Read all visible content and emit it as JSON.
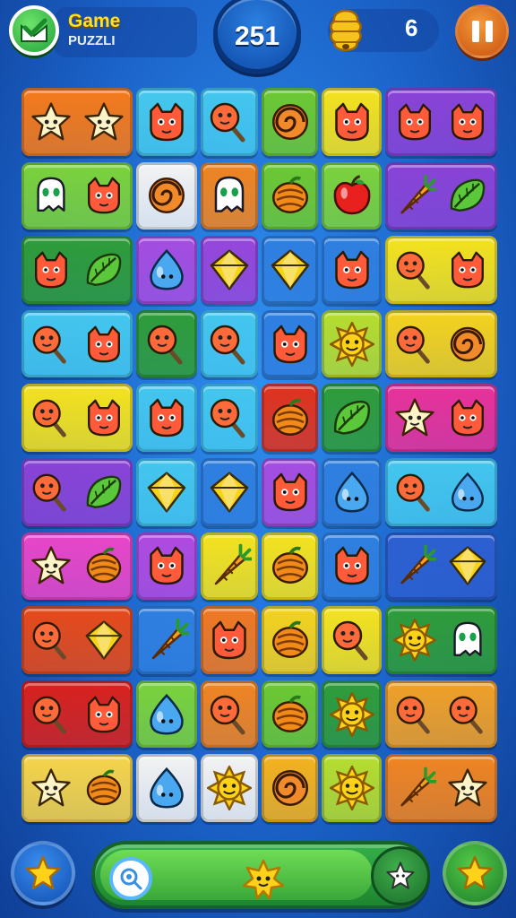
{
  "header": {
    "game_title": "Game",
    "game_subtitle": "PUZZLI",
    "score": "251",
    "hive_count": "6",
    "colors": {
      "title": "#ffe21a",
      "pause": "#e0731f",
      "score_ring": "#0e4aa8"
    }
  },
  "board": {
    "rows": [
      [
        {
          "color": "#f47a1c",
          "icons": [
            "star",
            "star"
          ]
        },
        {
          "color": "#46c8ec",
          "icons": [
            "cat"
          ]
        },
        {
          "color": "#44c6ee",
          "icons": [
            "lollipop"
          ]
        },
        {
          "color": "#6cc832",
          "icons": [
            "swirl"
          ]
        },
        {
          "color": "#f4e21e",
          "icons": [
            "cat"
          ]
        },
        {
          "color": "#8a43d6",
          "icons": [
            "cat",
            "cat"
          ]
        }
      ],
      [
        {
          "color": "#7bd23c",
          "icons": [
            "ghost",
            "cat"
          ]
        },
        {
          "color": "#f2f2f2",
          "icons": [
            "swirl"
          ]
        },
        {
          "color": "#f08422",
          "icons": [
            "ghost"
          ]
        },
        {
          "color": "#6cc832",
          "icons": [
            "fruit"
          ]
        },
        {
          "color": "#7bd23c",
          "icons": [
            "apple"
          ]
        },
        {
          "color": "#8a43d6",
          "icons": [
            "carrot",
            "leaf"
          ]
        }
      ],
      [
        {
          "color": "#2f9c3a",
          "icons": [
            "cat",
            "leaf"
          ]
        },
        {
          "color": "#a54de0",
          "icons": [
            "drop"
          ]
        },
        {
          "color": "#9646da",
          "icons": [
            "gem"
          ]
        },
        {
          "color": "#2f7fe0",
          "icons": [
            "gem"
          ]
        },
        {
          "color": "#2f7fe0",
          "icons": [
            "cat"
          ]
        },
        {
          "color": "#f4e21e",
          "icons": [
            "lollipop",
            "cat"
          ]
        }
      ],
      [
        {
          "color": "#44c6ee",
          "icons": [
            "lollipop",
            "cat"
          ]
        },
        {
          "color": "#2f9c3a",
          "icons": [
            "lollipop"
          ]
        },
        {
          "color": "#44c6ee",
          "icons": [
            "lollipop"
          ]
        },
        {
          "color": "#2f7fe0",
          "icons": [
            "cat"
          ]
        },
        {
          "color": "#b6dd2e",
          "icons": [
            "sun"
          ]
        },
        {
          "color": "#f4d21e",
          "icons": [
            "lollipop",
            "swirl"
          ]
        }
      ],
      [
        {
          "color": "#f4e21e",
          "icons": [
            "lollipop",
            "cat"
          ]
        },
        {
          "color": "#44c6ee",
          "icons": [
            "cat"
          ]
        },
        {
          "color": "#44c6ee",
          "icons": [
            "lollipop"
          ]
        },
        {
          "color": "#e0321e",
          "icons": [
            "fruit"
          ]
        },
        {
          "color": "#2f9c3a",
          "icons": [
            "leaf"
          ]
        },
        {
          "color": "#e8329a",
          "icons": [
            "star",
            "cat"
          ]
        }
      ],
      [
        {
          "color": "#8a43d6",
          "icons": [
            "lollipop",
            "leaf"
          ]
        },
        {
          "color": "#44c6ee",
          "icons": [
            "gem"
          ]
        },
        {
          "color": "#2f7fe0",
          "icons": [
            "gem"
          ]
        },
        {
          "color": "#a54de0",
          "icons": [
            "cat"
          ]
        },
        {
          "color": "#2f7fe0",
          "icons": [
            "drop"
          ]
        },
        {
          "color": "#44c6ee",
          "icons": [
            "lollipop",
            "drop"
          ]
        }
      ],
      [
        {
          "color": "#e846c8",
          "icons": [
            "star",
            "fruit"
          ]
        },
        {
          "color": "#b04ae0",
          "icons": [
            "cat"
          ]
        },
        {
          "color": "#f4e21e",
          "icons": [
            "carrot"
          ]
        },
        {
          "color": "#f4e21e",
          "icons": [
            "fruit"
          ]
        },
        {
          "color": "#2f7fe0",
          "icons": [
            "cat"
          ]
        },
        {
          "color": "#2d5fd0",
          "icons": [
            "carrot",
            "gem"
          ]
        }
      ],
      [
        {
          "color": "#e64a1a",
          "icons": [
            "lollipop",
            "gem"
          ]
        },
        {
          "color": "#2f7fe0",
          "icons": [
            "carrot"
          ]
        },
        {
          "color": "#f07822",
          "icons": [
            "cat"
          ]
        },
        {
          "color": "#f4d21e",
          "icons": [
            "fruit"
          ]
        },
        {
          "color": "#f4e21e",
          "icons": [
            "lollipop"
          ]
        },
        {
          "color": "#2f9c3a",
          "icons": [
            "sun",
            "ghost"
          ]
        }
      ],
      [
        {
          "color": "#d8221e",
          "icons": [
            "lollipop",
            "cat"
          ]
        },
        {
          "color": "#7bd23c",
          "icons": [
            "drop"
          ]
        },
        {
          "color": "#f08422",
          "icons": [
            "lollipop"
          ]
        },
        {
          "color": "#6cc832",
          "icons": [
            "fruit"
          ]
        },
        {
          "color": "#2f9c3a",
          "icons": [
            "sun"
          ]
        },
        {
          "color": "#f0a028",
          "icons": [
            "lollipop",
            "lollipop"
          ]
        }
      ],
      [
        {
          "color": "#f6d44a",
          "icons": [
            "star",
            "fruit"
          ]
        },
        {
          "color": "#f2f2f2",
          "icons": [
            "drop"
          ]
        },
        {
          "color": "#f2f2f2",
          "icons": [
            "sun"
          ]
        },
        {
          "color": "#f4b21e",
          "icons": [
            "swirl"
          ]
        },
        {
          "color": "#b6dd2e",
          "icons": [
            "sun"
          ]
        },
        {
          "color": "#f08422",
          "icons": [
            "carrot",
            "star"
          ]
        }
      ]
    ]
  },
  "footer": {
    "left_button_icon": "star-icon",
    "right_button_icon": "star-icon",
    "progress_start_icon": "lollipop-icon",
    "progress_mid_icon": "star-creature-icon",
    "progress_end_icon": "star-icon",
    "progress": 0.85
  }
}
